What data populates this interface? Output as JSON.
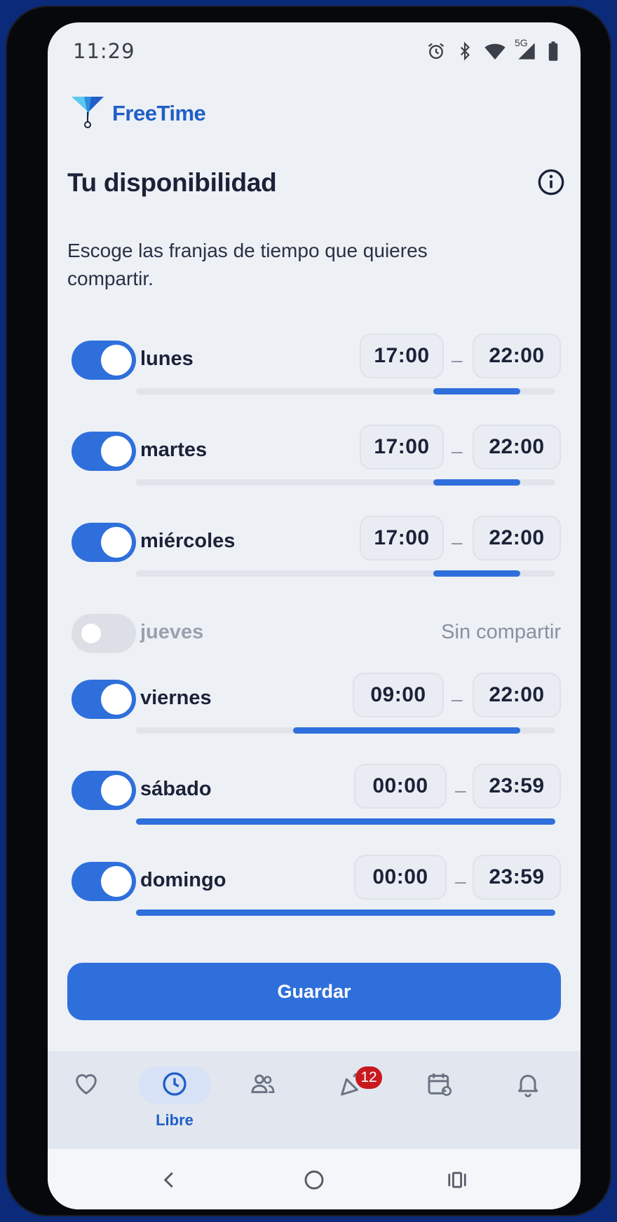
{
  "status_bar": {
    "time": "11:29",
    "network": "5G",
    "icons": [
      "alarm-icon",
      "bluetooth-icon",
      "wifi-icon",
      "signal-icon",
      "battery-icon"
    ]
  },
  "app": {
    "name": "FreeTime"
  },
  "page": {
    "title": "Tu disponibilidad",
    "subtitle": "Escoge las franjas de tiempo que quieres compartir."
  },
  "days": [
    {
      "name": "lunes",
      "enabled": true,
      "start": "17:00",
      "end": "22:00"
    },
    {
      "name": "martes",
      "enabled": true,
      "start": "17:00",
      "end": "22:00"
    },
    {
      "name": "miércoles",
      "enabled": true,
      "start": "17:00",
      "end": "22:00"
    },
    {
      "name": "jueves",
      "enabled": false,
      "status": "Sin compartir"
    },
    {
      "name": "viernes",
      "enabled": true,
      "start": "09:00",
      "end": "22:00"
    },
    {
      "name": "sábado",
      "enabled": true,
      "start": "00:00",
      "end": "23:59"
    },
    {
      "name": "domingo",
      "enabled": true,
      "start": "00:00",
      "end": "23:59"
    }
  ],
  "separator": "–",
  "actions": {
    "save_label": "Guardar"
  },
  "bottom_nav": {
    "items": [
      {
        "icon": "heart-icon",
        "label": ""
      },
      {
        "icon": "clock-icon",
        "label": "Libre",
        "active": true
      },
      {
        "icon": "people-icon",
        "label": ""
      },
      {
        "icon": "party-icon",
        "label": "",
        "badge": "12"
      },
      {
        "icon": "calendar-icon",
        "label": ""
      },
      {
        "icon": "bell-icon",
        "label": ""
      }
    ]
  },
  "colors": {
    "accent": "#2f6fdc",
    "brand": "#1f5fc6",
    "badge": "#c8191f",
    "text": "#1b2238"
  }
}
